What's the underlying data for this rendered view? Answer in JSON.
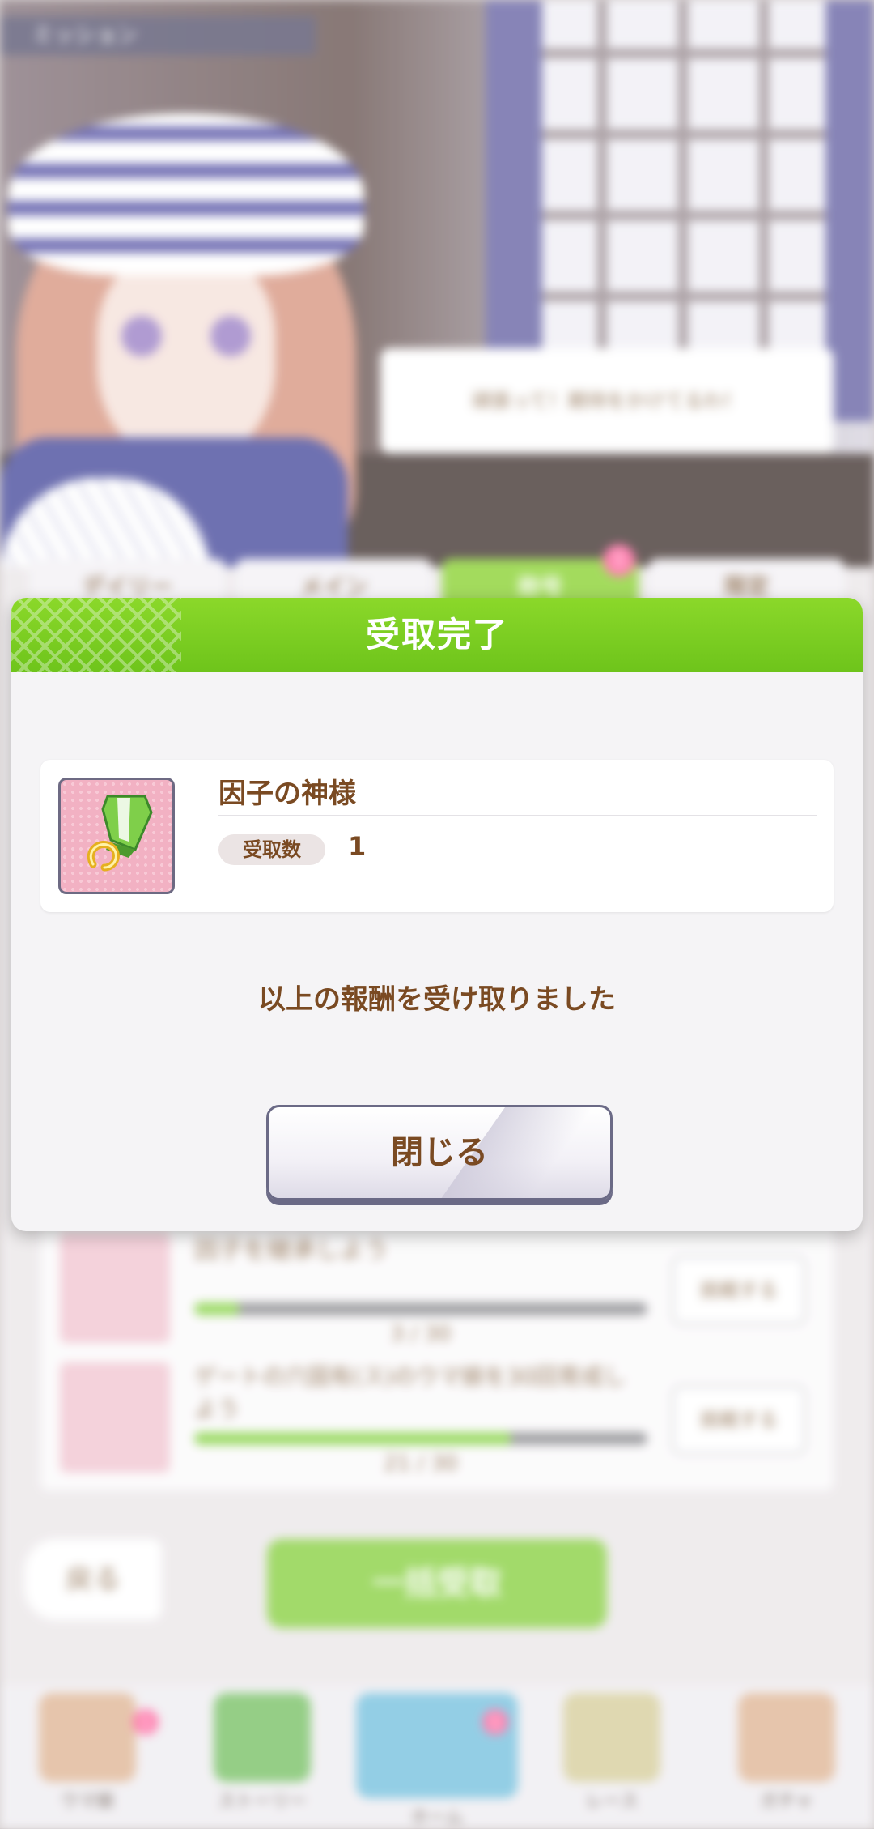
{
  "background": {
    "location_label": "ミッション",
    "speech_text": "頑張って！期待をかけてるわ！",
    "tabs": [
      {
        "label": "デイリー"
      },
      {
        "label": "メイン"
      },
      {
        "label": "称号"
      },
      {
        "label": "限定"
      }
    ],
    "tab_badge": "1",
    "missions": [
      {
        "title": "因子を継承しよう",
        "progress": "3 / 30",
        "progress_fraction": 0.1,
        "button": "挑戦する"
      },
      {
        "title": "ゲートの穴固有(ス)のウマ娘を30回育成しよう",
        "progress": "21 / 30",
        "progress_fraction": 0.7,
        "button": "挑戦する"
      }
    ],
    "back_button": "戻る",
    "bulk_receive_button": "一括受取",
    "nav": [
      {
        "label": "ウマ娘",
        "badge": "1"
      },
      {
        "label": "ストーリー",
        "badge": ""
      },
      {
        "label": "ホーム",
        "badge": "1"
      },
      {
        "label": "レース",
        "badge": ""
      },
      {
        "label": "ガチャ",
        "badge": ""
      }
    ]
  },
  "dialog": {
    "title": "受取完了",
    "reward": {
      "icon": "green-ribbon-horseshoe-icon",
      "name": "因子の神様",
      "quantity_label": "受取数",
      "quantity": "1"
    },
    "message": "以上の報酬を受け取りました",
    "close_button": "閉じる"
  },
  "colors": {
    "header_green": "#8bd82a",
    "text_brown": "#7a4a22",
    "button_border": "#6b6a86",
    "icon_pink": "#f3b9c9"
  }
}
